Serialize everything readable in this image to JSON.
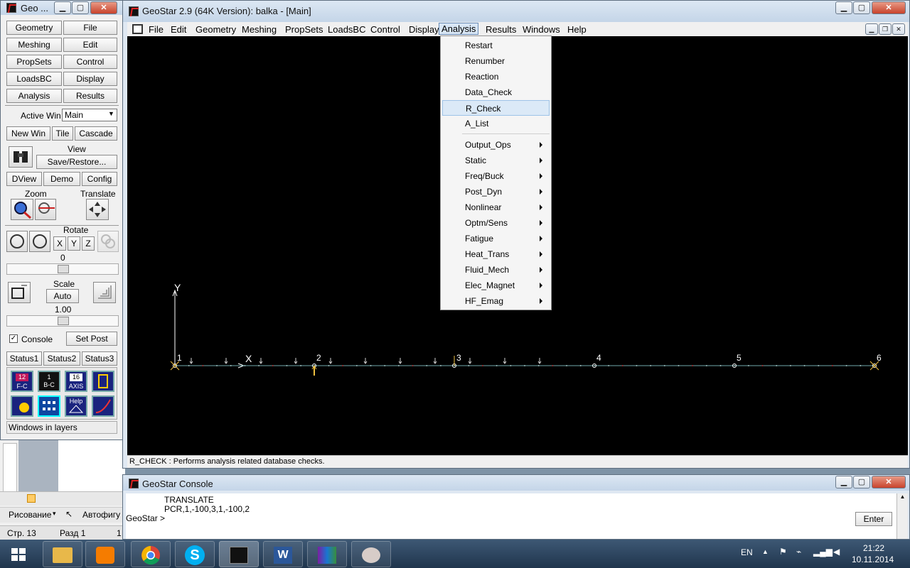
{
  "colors": {
    "canvas": "#000000",
    "axis": "#ffffff",
    "beam": "#6fa8ab",
    "load": "#d0d0d0",
    "support": "#f0c040"
  },
  "toolbox": {
    "title": "Geo ...",
    "buttons": [
      "Geometry",
      "File",
      "Meshing",
      "Edit",
      "PropSets",
      "Control",
      "LoadsBC",
      "Display",
      "Analysis",
      "Results"
    ],
    "active_win_label": "Active Win",
    "active_win_value": "Main",
    "win_buttons": [
      "New Win",
      "Tile",
      "Cascade"
    ],
    "view_label": "View",
    "save_restore": "Save/Restore...",
    "row2": [
      "DView",
      "Demo",
      "Config"
    ],
    "zoom_label": "Zoom",
    "translate_label": "Translate",
    "rotate_label": "Rotate",
    "axes": [
      "X",
      "Y",
      "Z"
    ],
    "rotate_value": "0",
    "scale_label": "Scale",
    "scale_auto": "Auto",
    "scale_value": "1.00",
    "console_label": "Console",
    "set_post": "Set Post",
    "status_tabs": [
      "Status1",
      "Status2",
      "Status3"
    ],
    "icon_labels": [
      "12",
      "F-C",
      "1",
      "B-C",
      "16",
      "AXIS",
      "Help"
    ],
    "status_text": "Windows in layers"
  },
  "main": {
    "title": "GeoStar 2.9 (64K Version): balka - [Main]",
    "menu": [
      "File",
      "Edit",
      "Geometry",
      "Meshing",
      "PropSets",
      "LoadsBC",
      "Control",
      "Display",
      "Analysis",
      "Results",
      "Windows",
      "Help"
    ],
    "analysis_menu": {
      "items": [
        {
          "label": "Restart",
          "sub": false
        },
        {
          "label": "Renumber",
          "sub": false
        },
        {
          "label": "Reaction",
          "sub": false
        },
        {
          "label": "Data_Check",
          "sub": false
        },
        {
          "label": "R_Check",
          "sub": false,
          "selected": true
        },
        {
          "label": "A_List",
          "sub": false
        },
        {
          "label": "Output_Ops",
          "sub": true
        },
        {
          "label": "Static",
          "sub": true
        },
        {
          "label": "Freq/Buck",
          "sub": true
        },
        {
          "label": "Post_Dyn",
          "sub": true
        },
        {
          "label": "Nonlinear",
          "sub": true
        },
        {
          "label": "Optm/Sens",
          "sub": true
        },
        {
          "label": "Fatigue",
          "sub": true
        },
        {
          "label": "Heat_Trans",
          "sub": true
        },
        {
          "label": "Fluid_Mech",
          "sub": true
        },
        {
          "label": "Elec_Magnet",
          "sub": true
        },
        {
          "label": "HF_Emag",
          "sub": true
        }
      ]
    },
    "canvas": {
      "y_label": "Y",
      "x_label": "X",
      "nodes": [
        "1",
        "2",
        "3",
        "4",
        "5",
        "6"
      ]
    },
    "status": "R_CHECK : Performs analysis related database checks."
  },
  "console": {
    "title": "GeoStar Console",
    "lines": [
      "TRANSLATE",
      "PCR,1,-100,3,1,-100,2"
    ],
    "prompt": "GeoStar >",
    "enter": "Enter"
  },
  "word": {
    "drawing_menu": "Рисование",
    "autoshapes": "Автофигу",
    "page": "Стр. 13",
    "section": "Разд 1",
    "one": "1"
  },
  "taskbar": {
    "lang": "EN",
    "time": "21:22",
    "date": "10.11.2014"
  }
}
